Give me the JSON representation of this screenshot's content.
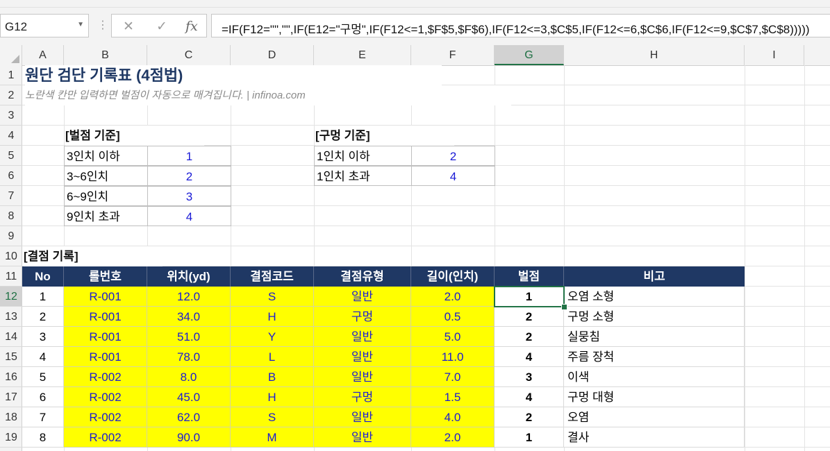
{
  "formula_bar": {
    "name_box": "G12",
    "cancel_icon": "✕",
    "enter_icon": "✓",
    "fx_icon": "fx",
    "formula": "=IF(F12=\"\",\"\",IF(E12=\"구멍\",IF(F12<=1,$F$5,$F$6),IF(F12<=3,$C$5,IF(F12<=6,$C$6,IF(F12<=9,$C$7,$C$8)))))"
  },
  "columns": [
    "A",
    "B",
    "C",
    "D",
    "E",
    "F",
    "G",
    "H",
    "I"
  ],
  "rows": [
    "1",
    "2",
    "3",
    "4",
    "5",
    "6",
    "7",
    "8",
    "9",
    "10",
    "11",
    "12",
    "13",
    "14",
    "15",
    "16",
    "17",
    "18",
    "19"
  ],
  "selected": {
    "column": "G",
    "row": "12"
  },
  "sheet": {
    "title": "원단 검단 기록표 (4점법)",
    "subtitle": "노란색 칸만 입력하면 벌점이 자동으로 매겨집니다. | infinoa.com",
    "penalty_header": "[벌점 기준]",
    "penalty_table": [
      {
        "label": "3인치 이하",
        "value": "1"
      },
      {
        "label": "3~6인치",
        "value": "2"
      },
      {
        "label": "6~9인치",
        "value": "3"
      },
      {
        "label": "9인치 초과",
        "value": "4"
      }
    ],
    "hole_header": "[구멍 기준]",
    "hole_table": [
      {
        "label": "1인치 이하",
        "value": "2"
      },
      {
        "label": "1인치 초과",
        "value": "4"
      }
    ],
    "defect_header": "[결점 기록]",
    "table_headers": [
      "No",
      "롤번호",
      "위치(yd)",
      "결점코드",
      "결점유형",
      "길이(인치)",
      "벌점",
      "비고"
    ],
    "records": [
      {
        "no": "1",
        "roll": "R-001",
        "pos": "12.0",
        "code": "S",
        "type": "일반",
        "len": "2.0",
        "pts": "1",
        "note": "오염 소형"
      },
      {
        "no": "2",
        "roll": "R-001",
        "pos": "34.0",
        "code": "H",
        "type": "구멍",
        "len": "0.5",
        "pts": "2",
        "note": "구멍 소형"
      },
      {
        "no": "3",
        "roll": "R-001",
        "pos": "51.0",
        "code": "Y",
        "type": "일반",
        "len": "5.0",
        "pts": "2",
        "note": "실뭉침"
      },
      {
        "no": "4",
        "roll": "R-001",
        "pos": "78.0",
        "code": "L",
        "type": "일반",
        "len": "11.0",
        "pts": "4",
        "note": "주름 장척"
      },
      {
        "no": "5",
        "roll": "R-002",
        "pos": "8.0",
        "code": "B",
        "type": "일반",
        "len": "7.0",
        "pts": "3",
        "note": "이색"
      },
      {
        "no": "6",
        "roll": "R-002",
        "pos": "45.0",
        "code": "H",
        "type": "구멍",
        "len": "1.5",
        "pts": "4",
        "note": "구멍 대형"
      },
      {
        "no": "7",
        "roll": "R-002",
        "pos": "62.0",
        "code": "S",
        "type": "일반",
        "len": "4.0",
        "pts": "2",
        "note": "오염"
      },
      {
        "no": "8",
        "roll": "R-002",
        "pos": "90.0",
        "code": "M",
        "type": "일반",
        "len": "2.0",
        "pts": "1",
        "note": "결사"
      }
    ]
  },
  "colors": {
    "header_navy": "#1f3864",
    "input_yellow": "#ffff00",
    "value_blue": "#1a1ad6",
    "excel_green": "#217346"
  }
}
